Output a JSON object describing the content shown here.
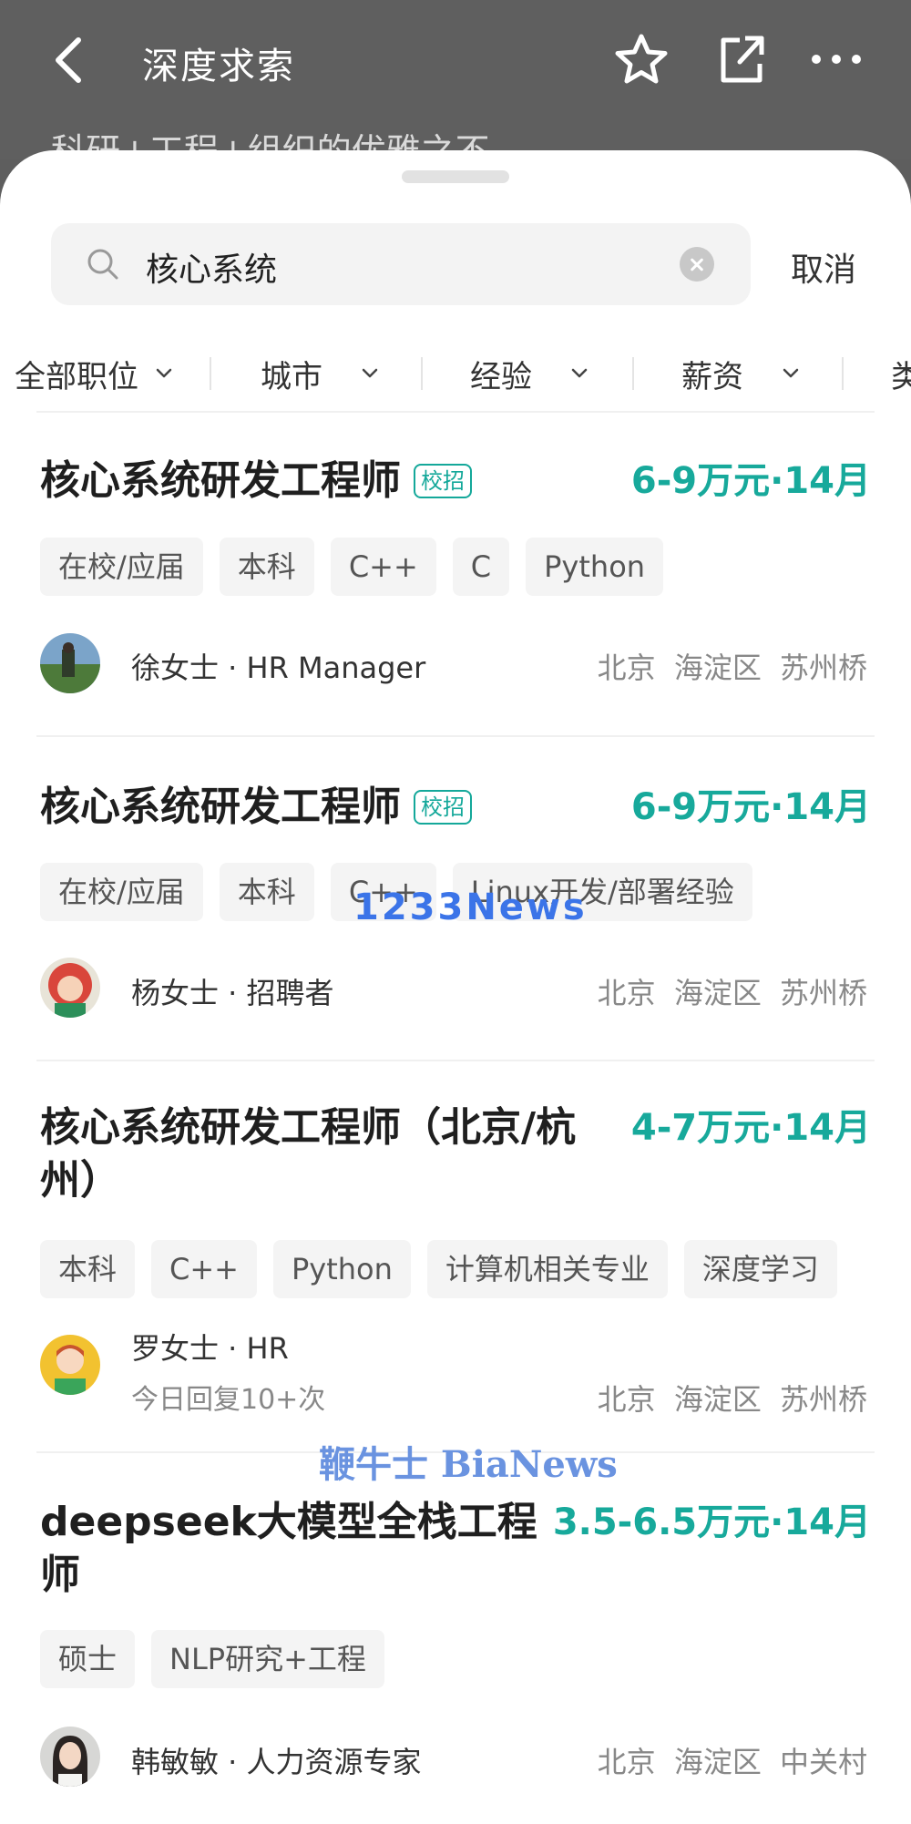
{
  "header": {
    "title": "深度求索",
    "peek_text": "科研+工程+组织的优雅之不。"
  },
  "search": {
    "query": "核心系统",
    "cancel_label": "取消"
  },
  "filters": [
    "全部职位",
    "城市",
    "经验",
    "薪资",
    "类"
  ],
  "jobs": [
    {
      "title": "核心系统研发工程师",
      "badge": "校招",
      "salary": "6-9万元·14月",
      "tags": [
        "在校/应届",
        "本科",
        "C++",
        "C",
        "Python"
      ],
      "recruiter": "徐女士 · HR Manager",
      "reply": "",
      "location": "北京 海淀区 苏州桥"
    },
    {
      "title": "核心系统研发工程师",
      "badge": "校招",
      "salary": "6-9万元·14月",
      "tags": [
        "在校/应届",
        "本科",
        "C++",
        "Linux开发/部署经验"
      ],
      "recruiter": "杨女士 · 招聘者",
      "reply": "",
      "location": "北京 海淀区 苏州桥"
    },
    {
      "title": "核心系统研发工程师（北京/杭州）",
      "badge": "",
      "salary": "4-7万元·14月",
      "tags": [
        "本科",
        "C++",
        "Python",
        "计算机相关专业",
        "深度学习"
      ],
      "recruiter": "罗女士 · HR",
      "reply": "今日回复10+次",
      "location": "北京 海淀区 苏州桥"
    },
    {
      "title": "deepseek大模型全栈工程师",
      "badge": "",
      "salary": "3.5-6.5万元·14月",
      "tags": [
        "硕士",
        "NLP研究+工程"
      ],
      "recruiter": "韩敏敏 · 人力资源专家",
      "reply": "",
      "location": "北京 海淀区 中关村"
    }
  ],
  "watermarks": [
    "1233News",
    "鞭牛士 BiaNews"
  ],
  "colors": {
    "accent": "#17a99b",
    "tag_bg": "#f4f4f4"
  }
}
